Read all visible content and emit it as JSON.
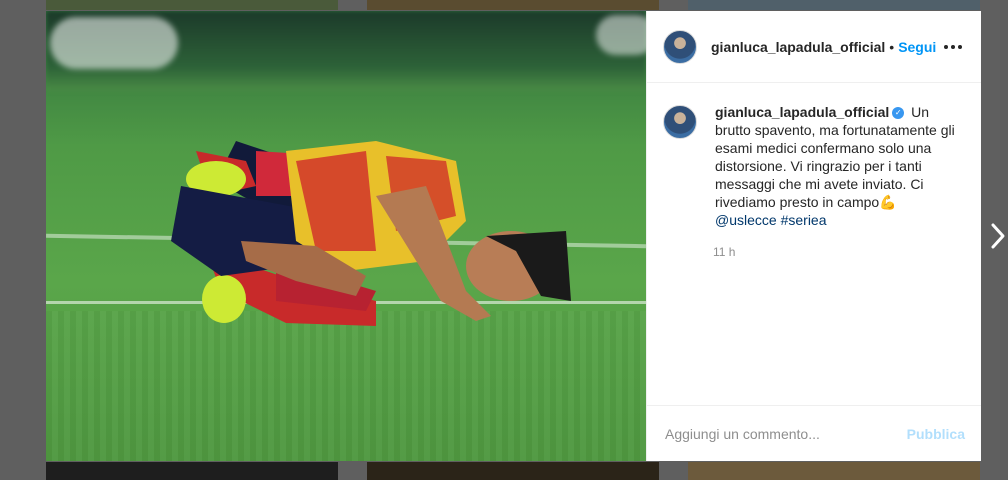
{
  "post": {
    "author": {
      "username": "gianluca_lapadula_official",
      "verified": true
    },
    "header": {
      "separator": "•",
      "follow_label": "Segui",
      "more_icon": "more-horizontal-icon"
    },
    "caption": {
      "text": "Un brutto spavento, ma fortunatamente gli esami medici confermano solo una distorsione. Vi ringrazio per i tanti messaggi che mi avete inviato. Ci rivediamo presto in campo",
      "emoji": "💪",
      "mentions": [
        "@uslecce"
      ],
      "hashtags": [
        "#seriea"
      ]
    },
    "timestamp": "11 h",
    "comment_box": {
      "placeholder": "Aggiungi un commento...",
      "post_label": "Pubblica"
    }
  },
  "navigation": {
    "next_icon": "chevron-right-icon"
  },
  "colors": {
    "accent": "#0095f6",
    "post_disabled": "#b2dffc",
    "backdrop": "#5f5f5f"
  }
}
